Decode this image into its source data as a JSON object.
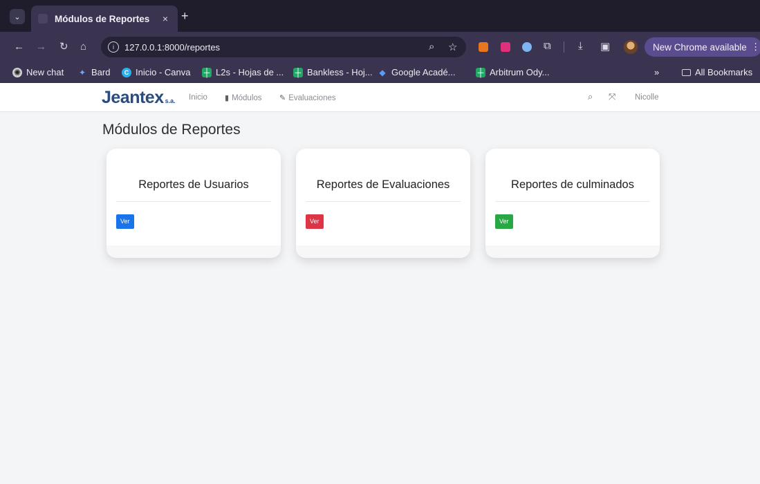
{
  "browser": {
    "tab_title": "Módulos de Reportes",
    "tab_close": "×",
    "new_tab": "+",
    "url": "127.0.0.1:8000/reportes",
    "update_label": "New Chrome available",
    "update_more": "⋮",
    "bookmarks": [
      {
        "label": "New chat",
        "icon": "chatgpt-icon",
        "color": "#ffffff"
      },
      {
        "label": "Bard",
        "icon": "bard-icon",
        "color": "#7aa2ff"
      },
      {
        "label": "Inicio - Canva",
        "icon": "canva-icon",
        "color": "#2bb0ed"
      },
      {
        "label": "L2s - Hojas de ...",
        "icon": "sheets-icon",
        "color": "#23a566"
      },
      {
        "label": "Bankless - Hoj...",
        "icon": "sheets-icon",
        "color": "#23a566"
      },
      {
        "label": "Google Acadé...",
        "icon": "scholar-icon",
        "color": "#5b9df5"
      },
      {
        "label": "Arbitrum Ody...",
        "icon": "sheets-icon",
        "color": "#23a566"
      }
    ],
    "bookmarks_overflow": "»",
    "all_bookmarks": "All Bookmarks"
  },
  "app": {
    "brand": "Jeantex",
    "brand_suffix": "s.a.",
    "nav": {
      "inicio": "Inicio",
      "modulos": "Módulos",
      "evaluaciones": "Evaluaciones"
    },
    "user": "Nicolle",
    "page_title": "Módulos de Reportes",
    "cards": [
      {
        "title": "Reportes de Usuarios",
        "button": "Ver",
        "color": "#1a73e8"
      },
      {
        "title": "Reportes de Evaluaciones",
        "button": "Ver",
        "color": "#dc3545"
      },
      {
        "title": "Reportes de culminados",
        "button": "Ver",
        "color": "#28a745"
      }
    ]
  }
}
